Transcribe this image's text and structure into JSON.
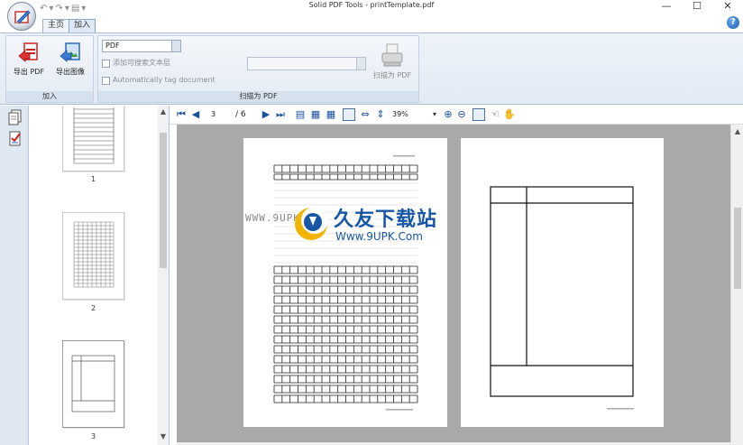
{
  "window": {
    "title": "Solid PDF Tools - printTemplate.pdf",
    "minimize": "—",
    "maximize": "☐",
    "close": "✕"
  },
  "qat": {
    "undo": "↶",
    "redo": "↷",
    "save": "▤",
    "more": "▾"
  },
  "tabs": [
    {
      "label": "主页",
      "active": false
    },
    {
      "label": "加入",
      "active": true
    }
  ],
  "help": "?",
  "ribbon": {
    "group_add": {
      "label": "加入",
      "export_pdf": "导出 PDF",
      "export_image": "导出图像"
    },
    "group_scan": {
      "label": "扫描为 PDF",
      "format_value": "PDF",
      "searchable_text": "添加可搜索文本层",
      "autotag": "Automatically tag document",
      "scanner_value": "",
      "scan_button": "扫描为 PDF"
    }
  },
  "thumbnails": [
    {
      "label": "1"
    },
    {
      "label": "2"
    },
    {
      "label": "3"
    }
  ],
  "viewer": {
    "current_page": "3",
    "total_pages": "/ 6",
    "zoom": "39%"
  },
  "watermark": {
    "small_url": "WWW.9UPK.COM",
    "cn_text": "久友下载站",
    "url": "Www.9UPK.Com"
  },
  "colors": {
    "ribbon_bg": "#e2eaf4",
    "accent_blue": "#1857a6",
    "doc_bg": "#a9a9a9"
  }
}
